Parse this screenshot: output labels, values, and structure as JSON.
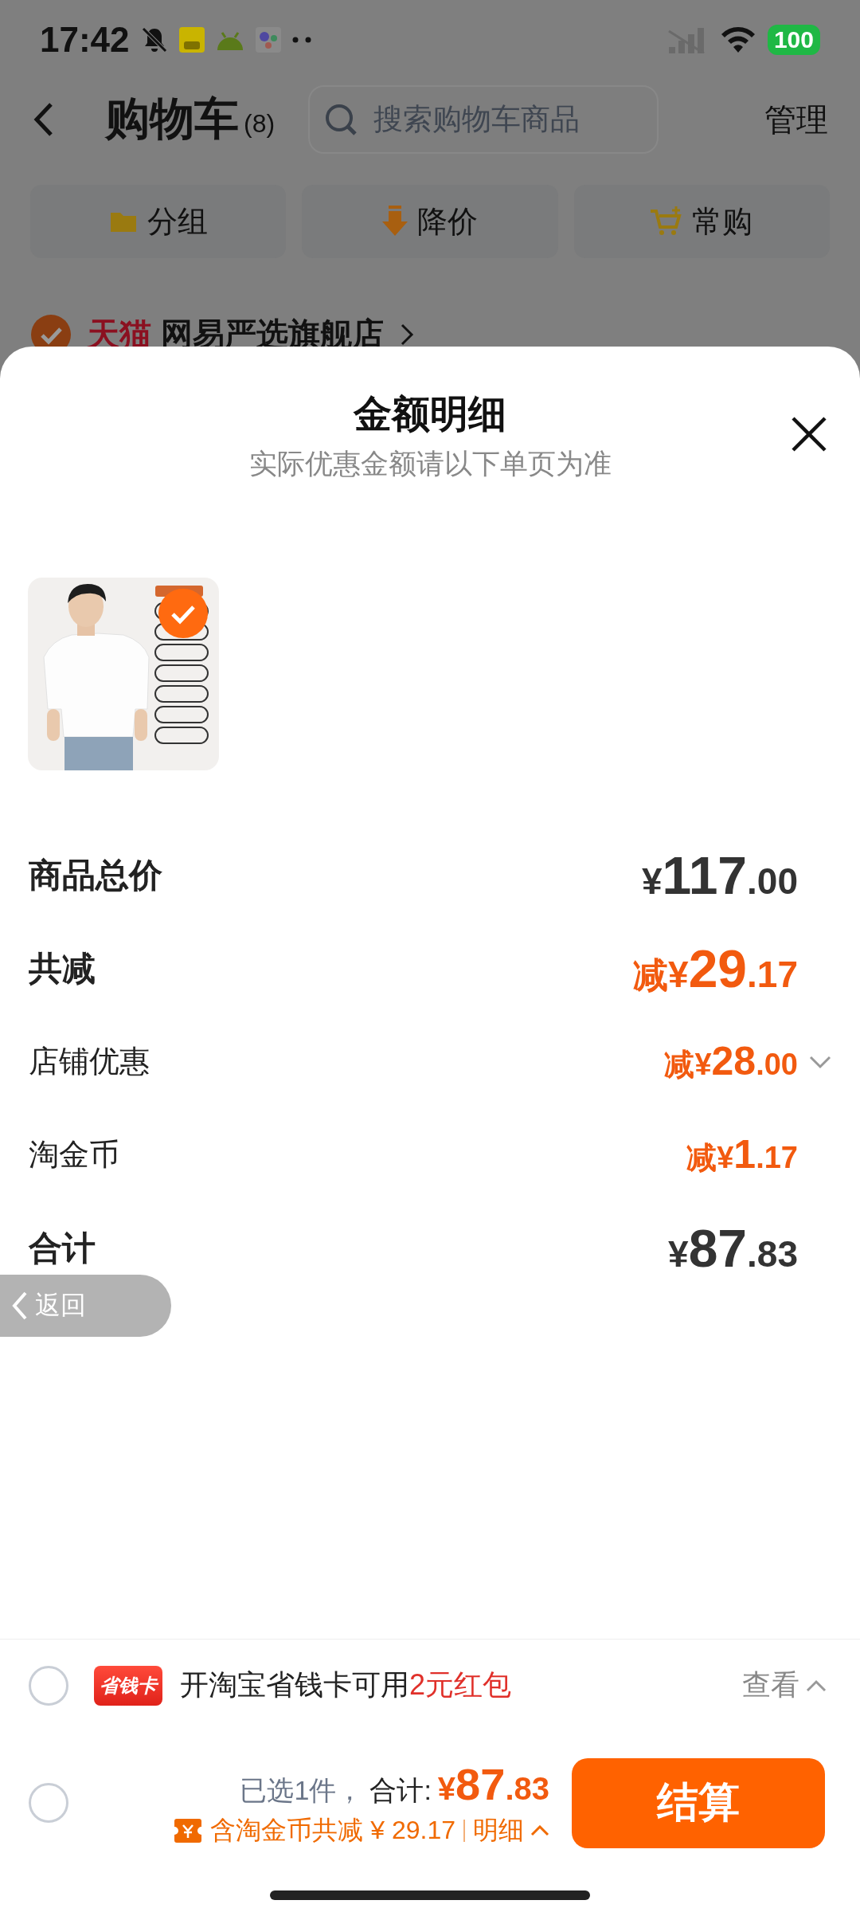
{
  "status_bar": {
    "time": "17:42",
    "battery": "100"
  },
  "header": {
    "title": "购物车",
    "count": "(8)",
    "search": {
      "placeholder": "搜索购物车商品"
    },
    "manage": "管理"
  },
  "quick_actions": [
    {
      "kind": "folder",
      "label": "分组"
    },
    {
      "kind": "price_drop",
      "label": "降价"
    },
    {
      "kind": "cart",
      "label": "常购"
    }
  ],
  "store": {
    "checked": true,
    "badge": "天猫",
    "name": "网易严选旗舰店"
  },
  "sheet": {
    "title": "金额明细",
    "subtitle": "实际优惠金额请以下单页为准",
    "products": [
      {
        "kind": "picture",
        "selected": true
      }
    ],
    "rows": [
      {
        "kind": "major",
        "label": "商品总价",
        "prefix": "",
        "currency": "¥",
        "value": "117.00",
        "discount": false,
        "expandable": false
      },
      {
        "kind": "major",
        "label": "共减",
        "prefix": "减",
        "currency": "¥",
        "value": "29.17",
        "discount": true,
        "expandable": false
      },
      {
        "kind": "minor",
        "label": "店铺优惠",
        "prefix": "减",
        "currency": "¥",
        "value": "28.00",
        "discount": true,
        "expandable": true
      },
      {
        "kind": "minor",
        "label": "淘金币",
        "prefix": "减",
        "currency": "¥",
        "value": "1.17",
        "discount": true,
        "expandable": false
      },
      {
        "kind": "major",
        "label": "合计",
        "prefix": "",
        "currency": "¥",
        "value": "87.83",
        "discount": false,
        "expandable": false
      }
    ]
  },
  "back_pill": {
    "label": "返回"
  },
  "promo": {
    "checked": false,
    "badge": "省钱卡",
    "text": "开淘宝省钱卡可用",
    "highlight": "2元红包",
    "action": "查看"
  },
  "checkout": {
    "checked": false,
    "selected_count": "已选1件，",
    "total_label": "合计:",
    "currency": "¥",
    "total": "87.83",
    "savings": "含淘金币共减 ¥ 29.17",
    "details": "明细",
    "button": "结算"
  }
}
